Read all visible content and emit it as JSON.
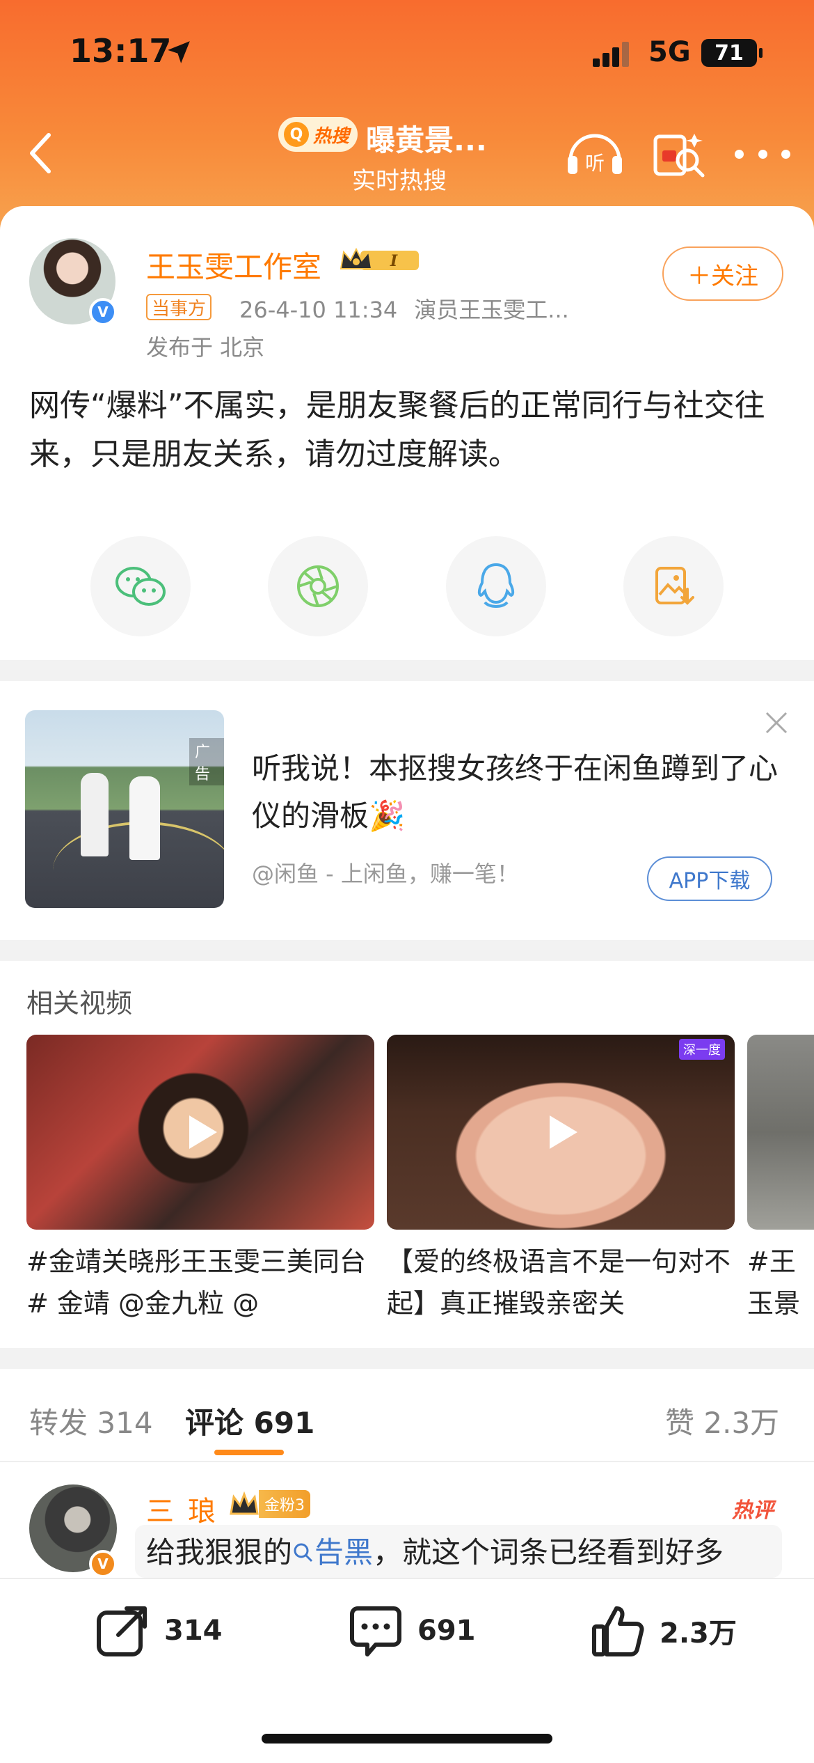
{
  "status_bar": {
    "time": "13:17",
    "network": "5G",
    "battery": "71"
  },
  "nav": {
    "hot_badge": "热搜",
    "title": "曝黄景...",
    "subtitle": "实时热搜",
    "listen_label": "听"
  },
  "post": {
    "author": "王玉雯工作室",
    "party_tag": "当事方",
    "datetime": "26-4-10 11:34",
    "source": "演员王玉雯工...",
    "location": "发布于 北京",
    "follow_label": "＋关注",
    "text": "网传“爆料”不属实，是朋友聚餐后的正常同行与社交往来，只是朋友关系，请勿过度解读。",
    "share_icons": [
      "wechat-icon",
      "moments-icon",
      "qq-icon",
      "save-image-icon"
    ]
  },
  "ad": {
    "label": "广告",
    "title": "听我说！本抠搜女孩终于在闲鱼蹲到了心仪的滑板🎉",
    "source": "@闲鱼 - 上闲鱼，赚一笔！",
    "download_label": "APP下载"
  },
  "related_videos": {
    "title": "相关视频",
    "items": [
      {
        "caption": "#金靖关晓彤王玉雯三美同台# 金靖 @金九粒 @",
        "badge": ""
      },
      {
        "caption": "【爱的终极语言不是一句对不起】真正摧毁亲密关",
        "badge": "深一度"
      },
      {
        "caption": "#王玉景瑜的",
        "badge": ""
      }
    ]
  },
  "tabs": {
    "repost_label": "转发",
    "repost_count": "314",
    "comment_label": "评论",
    "comment_count": "691",
    "like_label": "赞",
    "like_count": "2.3万"
  },
  "comment": {
    "user": "三_琅",
    "fan_level": "金粉3",
    "hot_tag": "热评",
    "text_prefix": "给我狠狠的",
    "keyword": "告黑",
    "text_suffix": "，就这个词条已经看到好多"
  },
  "bottom_bar": {
    "repost": "314",
    "comment": "691",
    "like": "2.3万"
  },
  "colors": {
    "accent": "#ff7a00",
    "header": "#f86c2e",
    "link": "#3f78cc"
  }
}
